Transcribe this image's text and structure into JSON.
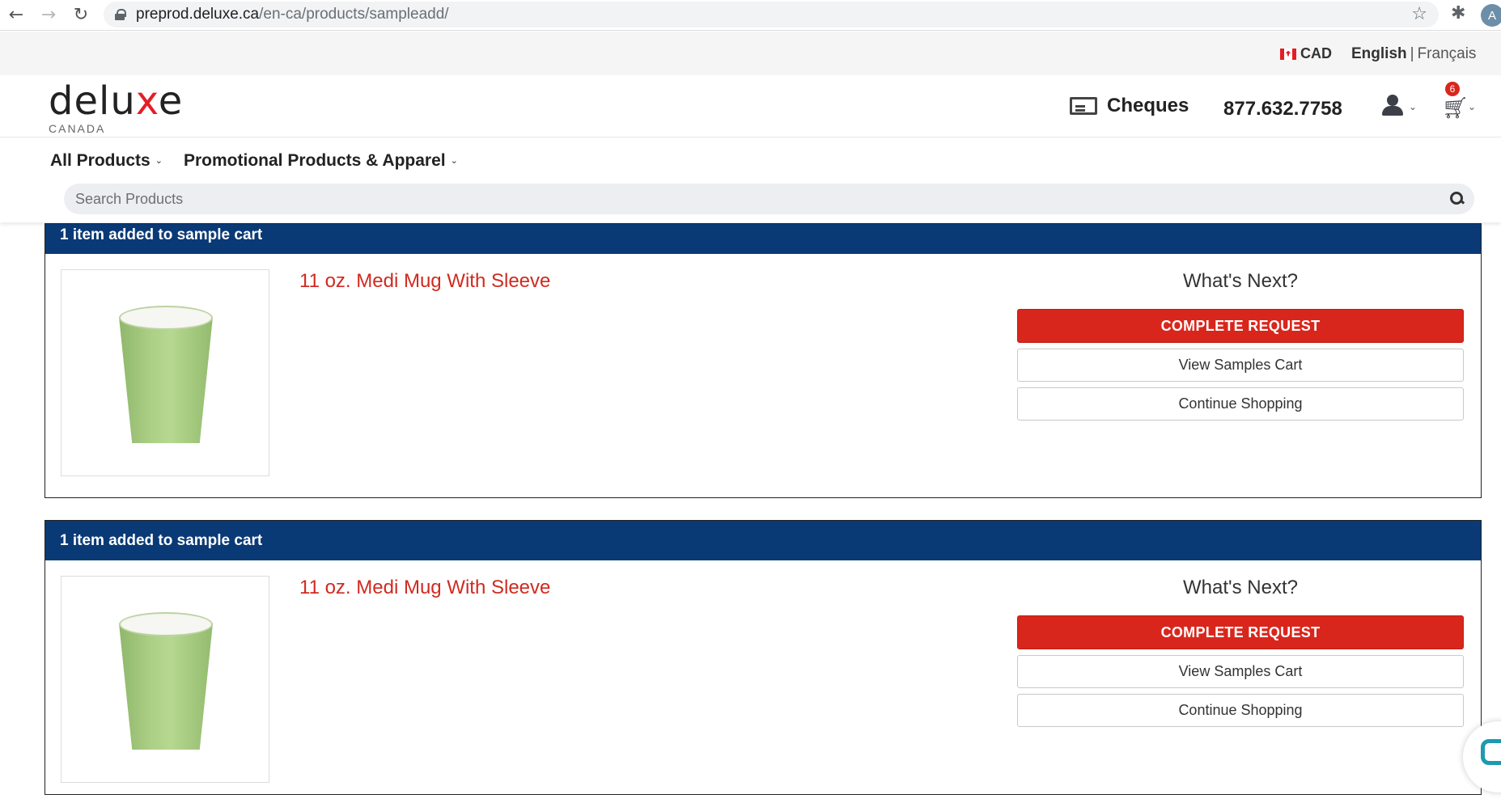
{
  "browser": {
    "url_host": "preprod.deluxe.ca",
    "url_path": "/en-ca/products/sampleadd/",
    "profile_initial": "A"
  },
  "utility": {
    "currency": "CAD",
    "lang_active": "English",
    "lang_sep": "|",
    "lang_alt": "Français"
  },
  "header": {
    "logo_main_1": "delu",
    "logo_main_x": "x",
    "logo_main_2": "e",
    "logo_sub": "CANADA",
    "cheques_label": "Cheques",
    "phone": "877.632.7758",
    "cart_count": "6"
  },
  "nav": {
    "all_products": "All Products",
    "promo": "Promotional Products & Apparel",
    "search_placeholder": "Search Products"
  },
  "cards": [
    {
      "header": "1 item added to sample cart",
      "product_name": "11 oz. Medi Mug With Sleeve",
      "whats_next": "What's Next?",
      "complete_label": "COMPLETE REQUEST",
      "view_cart_label": "View Samples Cart",
      "continue_label": "Continue Shopping"
    },
    {
      "header": "1 item added to sample cart",
      "product_name": "11 oz. Medi Mug With Sleeve",
      "whats_next": "What's Next?",
      "complete_label": "COMPLETE REQUEST",
      "view_cart_label": "View Samples Cart",
      "continue_label": "Continue Shopping"
    }
  ],
  "colors": {
    "brand_red": "#d9261c",
    "header_blue": "#0a3a76",
    "product_link": "#d02a20"
  }
}
